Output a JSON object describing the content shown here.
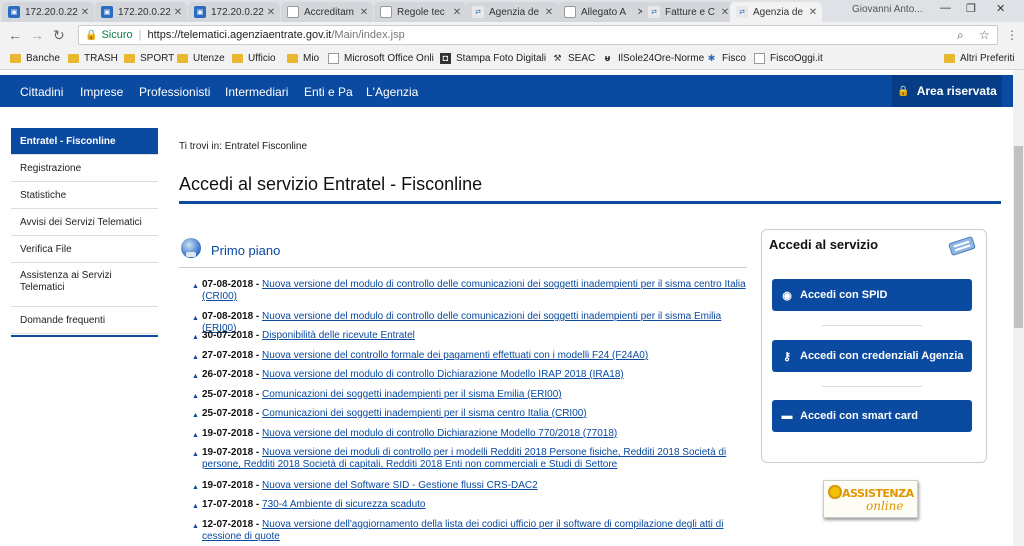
{
  "browser": {
    "tabs": [
      {
        "title": "172.20.0.22",
        "icon": "blue-square-icon"
      },
      {
        "title": "172.20.0.22",
        "icon": "blue-square-icon"
      },
      {
        "title": "172.20.0.22",
        "icon": "blue-square-icon"
      },
      {
        "title": "Accreditam",
        "icon": "page-icon"
      },
      {
        "title": "Regole tec",
        "icon": "page-icon"
      },
      {
        "title": "Agenzia de",
        "icon": "agenzia-icon"
      },
      {
        "title": "Allegato A",
        "icon": "page-icon"
      },
      {
        "title": "Fatture e C",
        "icon": "agenzia-icon"
      },
      {
        "title": "Agenzia de",
        "icon": "agenzia-icon"
      }
    ],
    "user": "Giovanni Anto...",
    "url_secure": "Sicuro",
    "url_host": "https://telematici.agenziaentrate.gov.it",
    "url_path": "/Main/index.jsp",
    "bookmarks": [
      {
        "label": "Banche",
        "icon": "folder-icon"
      },
      {
        "label": "TRASH",
        "icon": "folder-icon"
      },
      {
        "label": "SPORT",
        "icon": "folder-icon"
      },
      {
        "label": "Utenze",
        "icon": "folder-icon"
      },
      {
        "label": "Ufficio",
        "icon": "folder-icon"
      },
      {
        "label": "Mio",
        "icon": "folder-icon"
      },
      {
        "label": "Microsoft Office Onli",
        "icon": "page-icon"
      },
      {
        "label": "Stampa Foto Digitali",
        "icon": "camera-icon"
      },
      {
        "label": "SEAC",
        "icon": "seac-icon"
      },
      {
        "label": "IlSole24Ore-Norme",
        "icon": "sole-icon"
      },
      {
        "label": "Fisco",
        "icon": "star-icon"
      },
      {
        "label": "FiscoOggi.it",
        "icon": "page-icon"
      }
    ],
    "other_bookmarks": "Altri Preferiti"
  },
  "topnav": {
    "items": [
      "Cittadini",
      "Imprese",
      "Professionisti",
      "Intermediari",
      "Enti e Pa",
      "L'Agenzia"
    ],
    "area_riservata": "Area riservata"
  },
  "sidebar": {
    "items": [
      "Entratel - Fisconline",
      "Registrazione",
      "Statistiche",
      "Avvisi dei Servizi Telematici",
      "Verifica File",
      "Assistenza ai Servizi Telematici",
      "Domande frequenti"
    ]
  },
  "main": {
    "breadcrumb_prefix": "Ti trovi in:",
    "breadcrumb_current": "Entratel Fisconline",
    "title": "Accedi al servizio Entratel - Fisconline",
    "primo_piano": "Primo piano",
    "news": [
      {
        "date": "07-08-2018",
        "text": "Nuova versione del modulo di controllo delle comunicazioni dei soggetti inadempienti per il sisma centro Italia (CRI00)"
      },
      {
        "date": "07-08-2018",
        "text": "Nuova versione del modulo di controllo delle comunicazioni dei soggetti inadempienti per il sisma Emilia (ERI00)"
      },
      {
        "date": "30-07-2018",
        "text": "Disponibilità delle ricevute Entratel"
      },
      {
        "date": "27-07-2018",
        "text": "Nuova versione del controllo formale dei pagamenti effettuati con i modelli F24 (F24A0)"
      },
      {
        "date": "26-07-2018",
        "text": "Nuova versione del modulo di controllo Dichiarazione Modello IRAP 2018 (IRA18)"
      },
      {
        "date": "25-07-2018",
        "text": "Comunicazioni dei soggetti inadempienti per il sisma Emilia (ERI00)"
      },
      {
        "date": "25-07-2018",
        "text": "Comunicazioni dei soggetti inadempienti per il sisma centro Italia (CRI00)"
      },
      {
        "date": "19-07-2018",
        "text": "Nuova versione del modulo di controllo Dichiarazione Modello 770/2018 (77018)"
      },
      {
        "date": "19-07-2018",
        "text": "Nuova versione dei moduli di controllo per i modelli Redditi 2018 Persone fisiche, Redditi 2018 Società di persone, Redditi 2018 Società di capitali, Redditi 2018 Enti non commerciali e Studi di Settore"
      },
      {
        "date": "19-07-2018",
        "text": "Nuova versione del Software SID - Gestione flussi CRS-DAC2"
      },
      {
        "date": "17-07-2018",
        "text": "730-4 Ambiente di sicurezza scaduto"
      },
      {
        "date": "12-07-2018",
        "text": "Nuova versione dell'aggiornamento della lista dei codici ufficio per il software di compilazione degli atti di cessione di quote"
      }
    ]
  },
  "access": {
    "title": "Accedi al servizio",
    "spid": "Accedi con SPID",
    "credenziali": "Accedi con credenziali Agenzia",
    "smartcard": "Accedi con smart card"
  },
  "assistenza": {
    "title": "ASSISTENZA",
    "subtitle": "online"
  },
  "colors": {
    "brand_blue": "#0a4aa0",
    "link_blue": "#0a4aa0",
    "assist_orange": "#e09500"
  }
}
